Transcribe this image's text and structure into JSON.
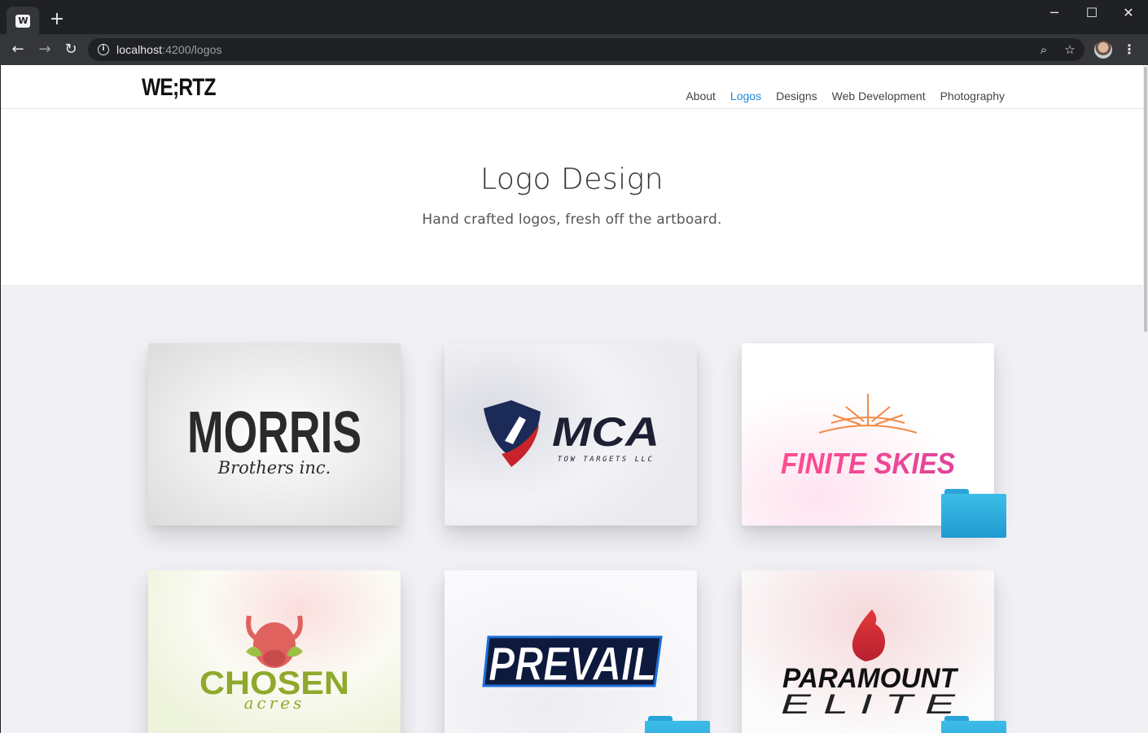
{
  "browser": {
    "tab_icon_text": "W",
    "new_tab": "+",
    "url_host": "localhost",
    "url_path": ":4200/logos",
    "controls": {
      "minimize": "─",
      "maximize": "☐",
      "close": "✕"
    }
  },
  "site": {
    "brand": "WE;RTZ",
    "nav": [
      {
        "label": "About",
        "active": false
      },
      {
        "label": "Logos",
        "active": true
      },
      {
        "label": "Designs",
        "active": false
      },
      {
        "label": "Web Development",
        "active": false
      },
      {
        "label": "Photography",
        "active": false
      }
    ]
  },
  "hero": {
    "title": "Logo Design",
    "subtitle": "Hand crafted logos, fresh off the artboard."
  },
  "cards": [
    {
      "name": "MORRIS",
      "tagline": "Brothers inc."
    },
    {
      "name": "MCA",
      "tagline": "TOW TARGETS LLC"
    },
    {
      "name": "FINITE SKIES"
    },
    {
      "name": "CHOSEN",
      "tagline": "acres"
    },
    {
      "name": "PREVAIL"
    },
    {
      "name": "PARAMOUNT",
      "tagline": "E L I T E"
    }
  ],
  "colors": {
    "accent": "#1e88d8",
    "page_bg": "#f1f1f5",
    "folder": "#2aa4d8"
  }
}
